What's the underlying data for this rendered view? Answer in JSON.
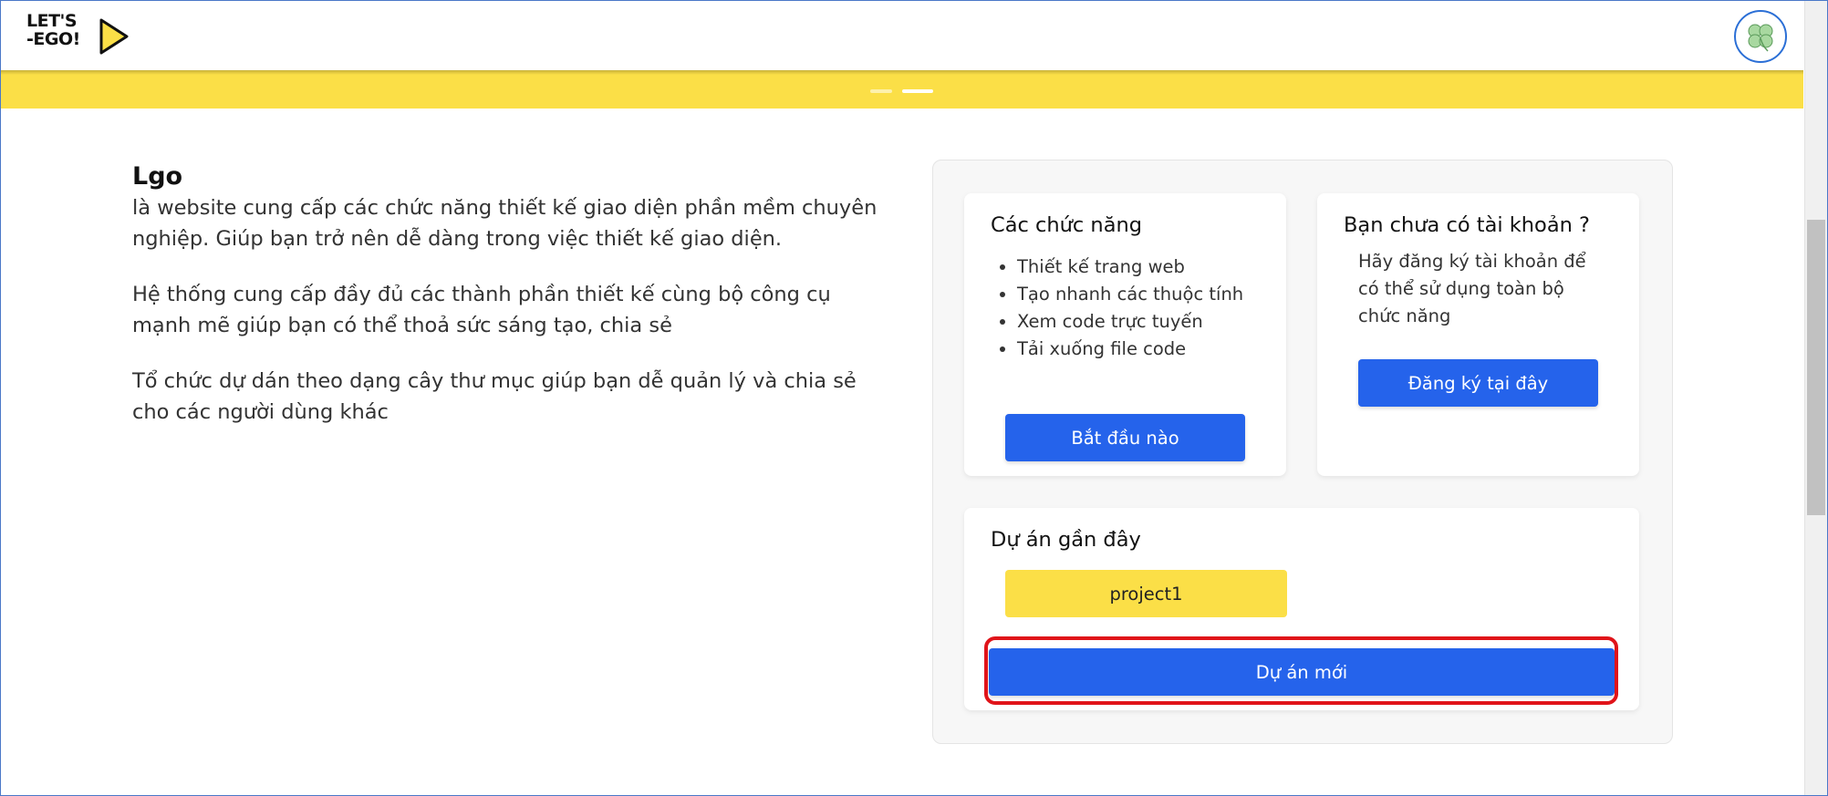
{
  "header": {
    "logo_line1": "LET'S",
    "logo_line2": "-EGO!",
    "avatar_icon": "clover-icon"
  },
  "colors": {
    "accent_blue": "#2563eb",
    "banner_yellow": "#fbdf47",
    "highlight_red": "#e0141a"
  },
  "banner": {
    "slides": 2,
    "active_slide": 2
  },
  "intro": {
    "title": "Lgo",
    "paragraphs": [
      "là website cung cấp các chức năng thiết kế giao diện phần mềm chuyên nghiệp. Giúp bạn trở nên dễ dàng trong việc thiết kế giao diện.",
      "Hệ thống cung cấp đầy đủ các thành phần thiết kế cùng bộ công cụ mạnh mẽ giúp bạn có thể thoả sức sáng tạo, chia sẻ",
      "Tổ chức dự dán theo dạng cây thư mục giúp bạn dễ quản lý và chia sẻ cho các người dùng khác"
    ]
  },
  "features_card": {
    "title": "Các chức năng",
    "items": [
      "Thiết kế trang web",
      "Tạo nhanh các thuộc tính",
      "Xem code trực tuyến",
      "Tải xuống file code"
    ],
    "button": "Bắt đầu nào"
  },
  "register_card": {
    "title": "Bạn chưa có tài khoản ?",
    "text": "Hãy đăng ký tài khoản để có thể sử dụng toàn bộ chức năng",
    "button": "Đăng ký tại đây"
  },
  "recent_card": {
    "title": "Dự án gần đây",
    "projects": [
      "project1"
    ],
    "new_button": "Dự án mới"
  }
}
